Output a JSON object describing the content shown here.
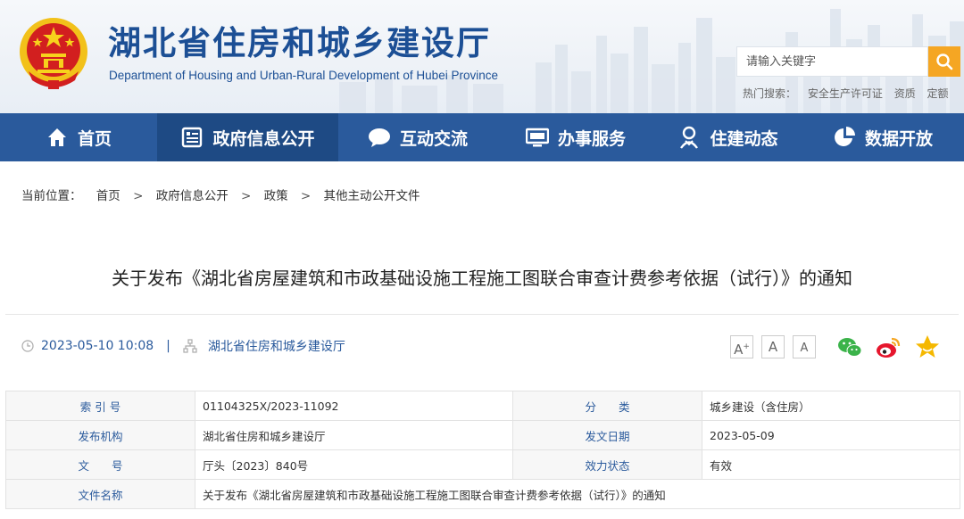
{
  "header": {
    "site_title": "湖北省住房和城乡建设厅",
    "site_subtitle": "Department of Housing and Urban-Rural Development of Hubei Province",
    "search_placeholder": "请输入关键字",
    "hot_search_label": "热门搜索：",
    "hot_search_terms": [
      "安全生产许可证",
      "资质",
      "定额"
    ],
    "accent_color": "#f5a623",
    "title_color": "#1c4f95"
  },
  "nav": {
    "background": "#2a5a9c",
    "items": [
      {
        "label": "首页",
        "icon": "home-icon"
      },
      {
        "label": "政府信息公开",
        "icon": "document-list-icon",
        "active": true
      },
      {
        "label": "互动交流",
        "icon": "chat-bubble-icon"
      },
      {
        "label": "办事服务",
        "icon": "monitor-icon"
      },
      {
        "label": "住建动态",
        "icon": "award-person-icon"
      },
      {
        "label": "数据开放",
        "icon": "pie-chart-icon"
      }
    ]
  },
  "breadcrumb": {
    "label": "当前位置：",
    "items": [
      "首页",
      "政府信息公开",
      "政策",
      "其他主动公开文件"
    ],
    "separator": ">"
  },
  "article": {
    "title": "关于发布《湖北省房屋建筑和市政基础设施工程施工图联合审查计费参考依据（试行）》的通知",
    "date": "2023-05-10 10:08",
    "divider": "|",
    "source": "湖北省住房和城乡建设厅"
  },
  "tools": {
    "font_large": "A",
    "font_medium": "A",
    "font_small": "A",
    "share": [
      "wechat-icon",
      "weibo-icon",
      "favorite-star-icon"
    ]
  },
  "info_table": {
    "index_label": "索 引 号",
    "index_value": "01104325X/2023-11092",
    "category_label": "分　　类",
    "category_value": "城乡建设（含住房）",
    "issuer_label": "发布机构",
    "issuer_value": "湖北省住房和城乡建设厅",
    "issue_date_label": "发文日期",
    "issue_date_value": "2023-05-09",
    "doc_no_label": "文　　号",
    "doc_no_value": "厅头〔2023〕840号",
    "status_label": "效力状态",
    "status_value": "有效",
    "doc_name_label": "文件名称",
    "doc_name_value": "关于发布《湖北省房屋建筑和市政基础设施工程施工图联合审查计费参考依据（试行）》的通知"
  }
}
